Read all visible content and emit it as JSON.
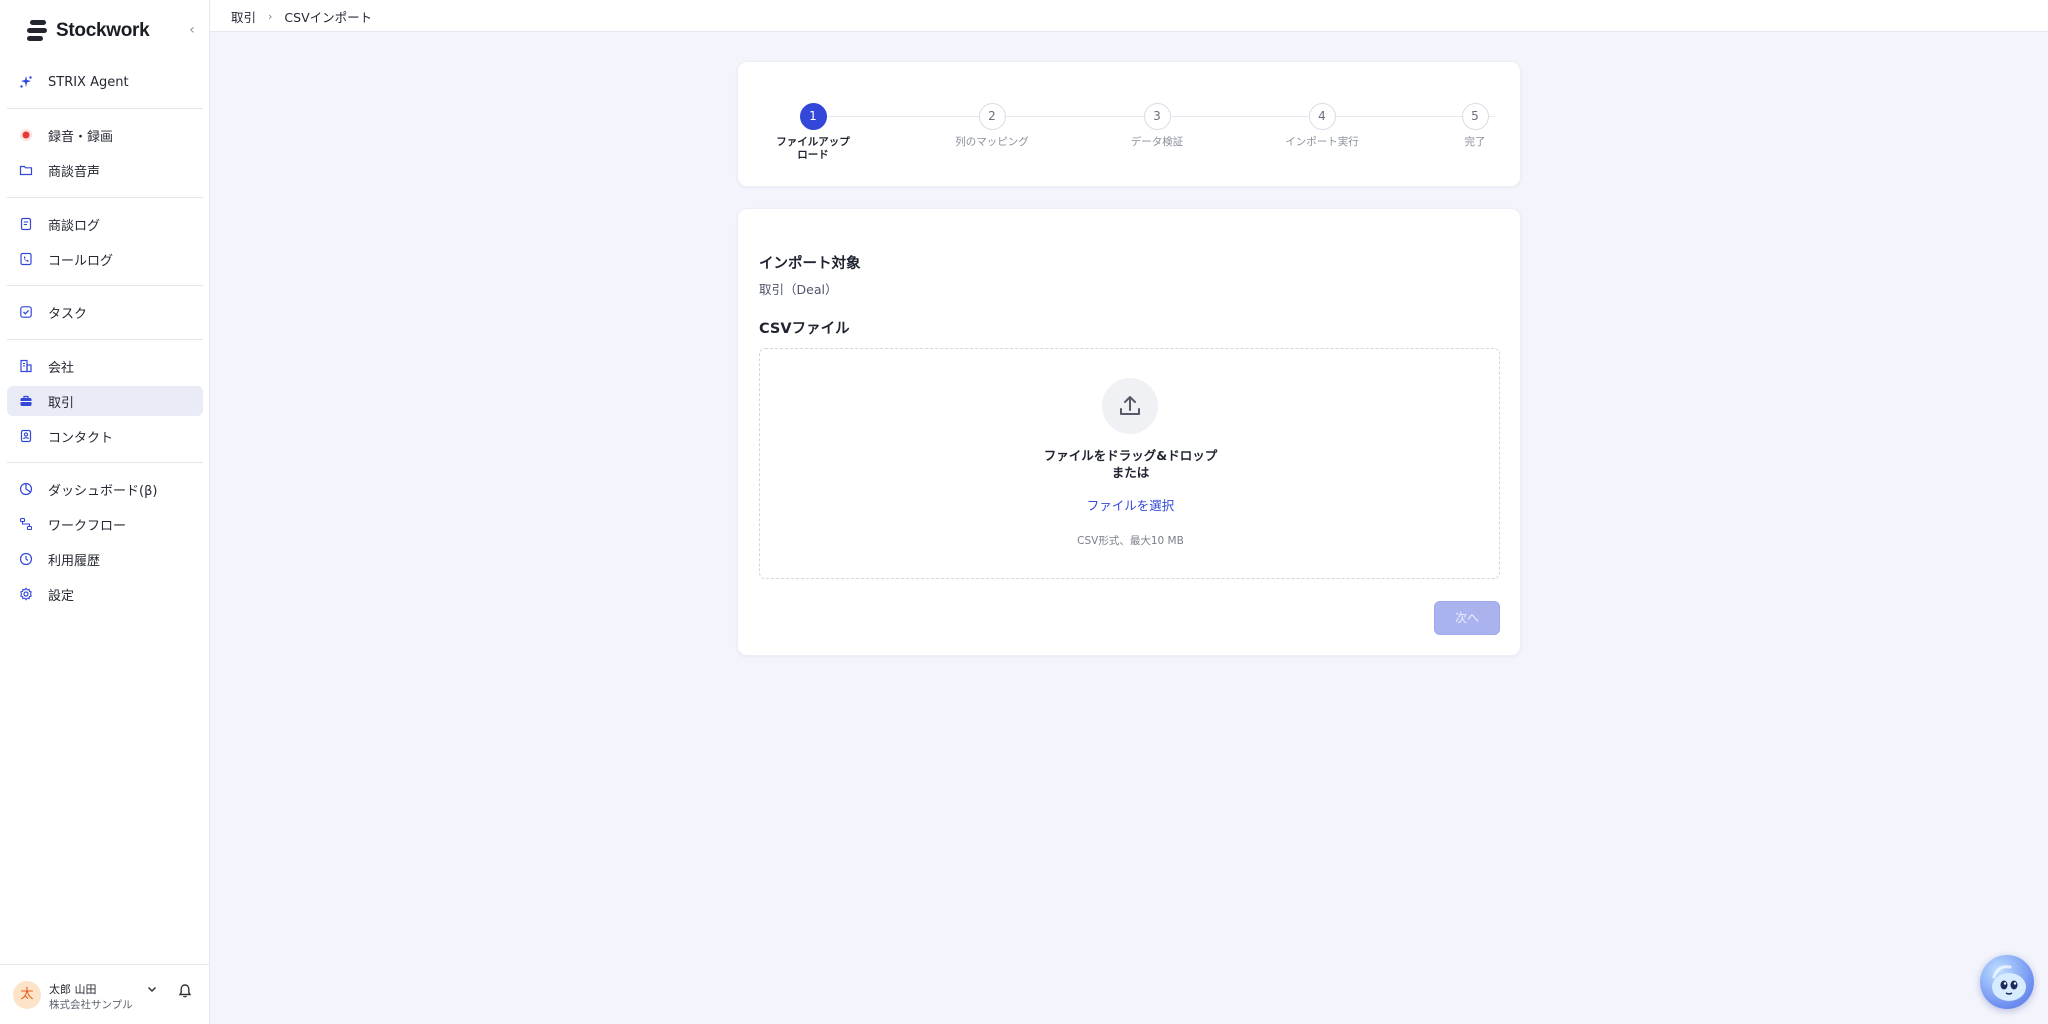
{
  "app": {
    "logo_text": "Stockwork"
  },
  "sidebar": {
    "items": [
      {
        "label": "STRIX Agent",
        "icon": "sparkle-icon"
      },
      {
        "label": "録音・録画",
        "icon": "record-icon"
      },
      {
        "label": "商談音声",
        "icon": "folder-icon"
      },
      {
        "label": "商談ログ",
        "icon": "document-icon"
      },
      {
        "label": "コールログ",
        "icon": "phone-icon"
      },
      {
        "label": "タスク",
        "icon": "checkbox-icon"
      },
      {
        "label": "会社",
        "icon": "building-icon"
      },
      {
        "label": "取引",
        "icon": "briefcase-icon",
        "active": true
      },
      {
        "label": "コンタクト",
        "icon": "contact-icon"
      },
      {
        "label": "ダッシュボード(β)",
        "icon": "chart-icon"
      },
      {
        "label": "ワークフロー",
        "icon": "workflow-icon"
      },
      {
        "label": "利用履歴",
        "icon": "history-icon"
      },
      {
        "label": "設定",
        "icon": "gear-icon"
      }
    ],
    "user": {
      "avatar": "太",
      "name": "太郎 山田",
      "org": "株式会社サンプル"
    }
  },
  "breadcrumb": [
    "取引",
    "CSVインポート"
  ],
  "stepper": {
    "steps": [
      {
        "num": "1",
        "label": "ファイルアップ\nロード",
        "active": true
      },
      {
        "num": "2",
        "label": "列のマッピング"
      },
      {
        "num": "3",
        "label": "データ検証"
      },
      {
        "num": "4",
        "label": "インポート実行"
      },
      {
        "num": "5",
        "label": "完了"
      }
    ]
  },
  "form": {
    "target_title": "インポート対象",
    "target_value": "取引（Deal）",
    "file_title": "CSVファイル",
    "dropzone_line1": "ファイルをドラッグ&ドロップ",
    "dropzone_line2": "または",
    "select_link": "ファイルを選択",
    "hint": "CSV形式、最大10 MB",
    "next_label": "次へ"
  },
  "colors": {
    "accent": "#3347d9",
    "background": "#f4f5fc",
    "disabled_button": "#aab3ee"
  }
}
